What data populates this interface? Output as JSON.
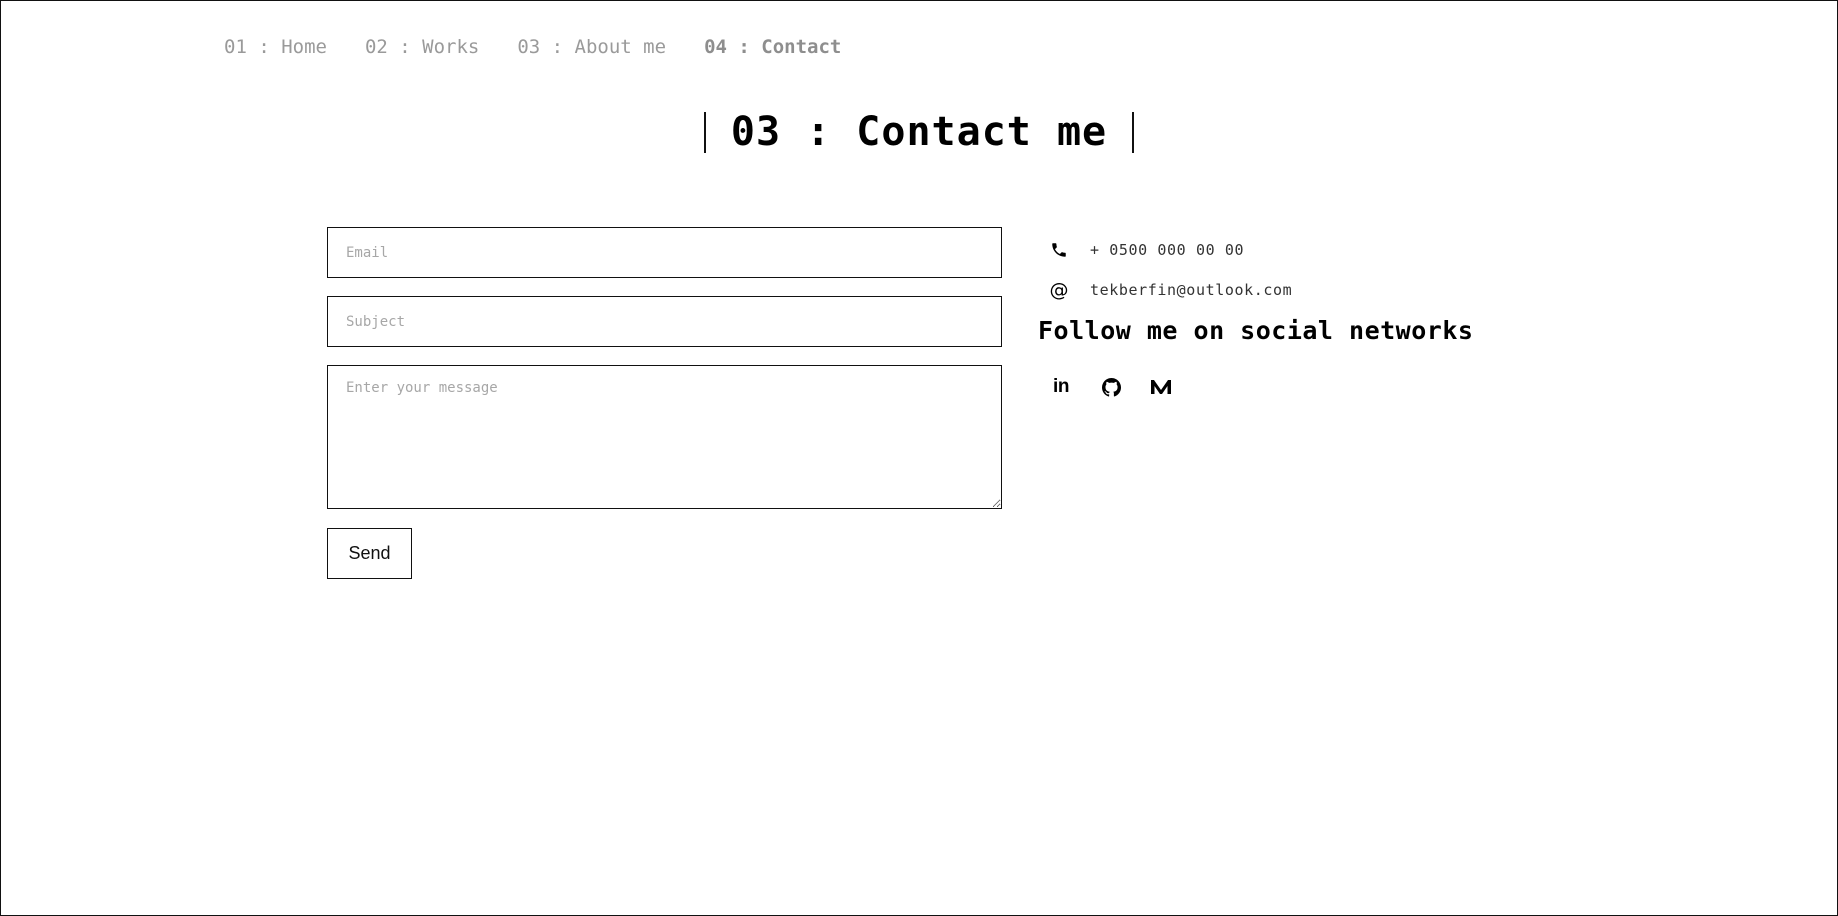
{
  "nav": {
    "items": [
      {
        "label": "01 : Home"
      },
      {
        "label": "02 : Works"
      },
      {
        "label": "03 : About me"
      },
      {
        "label": "04 : Contact",
        "active": true
      }
    ]
  },
  "page": {
    "title": "03 : Contact me"
  },
  "form": {
    "email_placeholder": "Email",
    "subject_placeholder": "Subject",
    "message_placeholder": "Enter your message",
    "send_label": "Send"
  },
  "contact": {
    "phone": "+ 0500 000 00 00",
    "phone_icon": "phone-icon",
    "email": "tekberfin@outlook.com",
    "email_icon": "at-sign-icon"
  },
  "social": {
    "title": "Follow me on social networks",
    "icons": [
      "linkedin-icon",
      "github-icon",
      "medium-icon"
    ],
    "linkedin_glyph": "in"
  },
  "colors": {
    "text": "#111111",
    "muted": "#9a9a9a",
    "border": "#111111",
    "background": "#ffffff"
  }
}
